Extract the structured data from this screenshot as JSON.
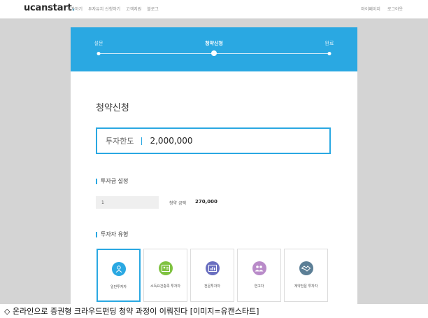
{
  "header": {
    "logo_main": "ucanstart",
    "logo_dot": ".",
    "nav": [
      "투자하기",
      "투자유치 신청하기",
      "고객지원",
      "블로그"
    ],
    "nav_right": [
      "마이페이지",
      "로그아웃"
    ]
  },
  "steps": {
    "items": [
      {
        "label": "설문",
        "active": false
      },
      {
        "label": "청약신청",
        "active": true
      },
      {
        "label": "완료",
        "active": false
      }
    ]
  },
  "page": {
    "title": "청약신청",
    "limit_label": "투자한도",
    "limit_value": "2,000,000"
  },
  "amount_section": {
    "title": "투자금 설정",
    "quantity_value": "1",
    "amount_label": "청약 금액",
    "amount_value": "270,000"
  },
  "type_section": {
    "title": "투자자 유형",
    "cards": [
      {
        "label": "일반투자자",
        "icon": "person-icon",
        "color": "#2aa8e2",
        "selected": true
      },
      {
        "label": "소득요건충족 투자자",
        "icon": "id-card-icon",
        "color": "#7fc241",
        "selected": false
      },
      {
        "label": "전문투자자",
        "icon": "chart-icon",
        "color": "#6a6fc0",
        "selected": false
      },
      {
        "label": "연고자",
        "icon": "people-icon",
        "color": "#b98bc9",
        "selected": false
      },
      {
        "label": "계약전문 투자자",
        "icon": "handshake-icon",
        "color": "#5c7f96",
        "selected": false
      }
    ]
  },
  "caption": "◇ 온라인으로 증권형 크라우드펀딩 청약 과정이 이뤄진다 [이미지=유캔스타트]",
  "colors": {
    "accent": "#2aa8e2",
    "background": "#d4d4d4"
  }
}
